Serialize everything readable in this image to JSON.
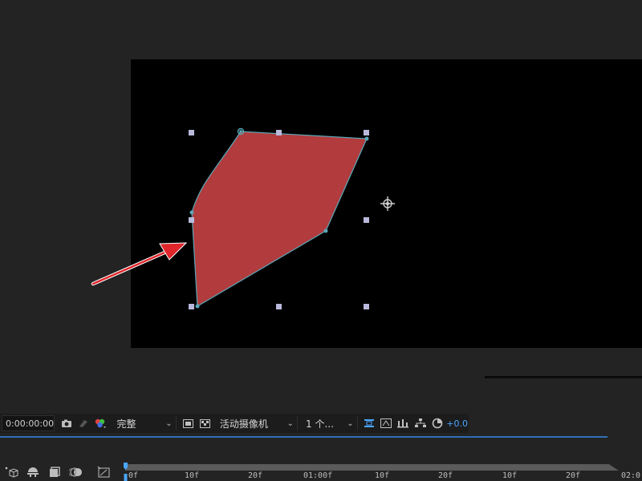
{
  "toolbar": {
    "timecode": "0:00:00:00",
    "resolution": "完整",
    "camera": "活动摄像机",
    "views": "1 个...",
    "exposure": "+0.0",
    "icons": [
      "camera-snapshot-icon",
      "show-snapshot-icon",
      "color-channel-icon",
      "toggle-mask-icon",
      "transparency-grid-icon",
      "fast-preview-icon",
      "timeline-icon",
      "flowchart-icon",
      "reset-exposure-icon"
    ]
  },
  "timeline": {
    "ticks": [
      "0f",
      "10f",
      "20f",
      "01:00f",
      "10f",
      "20f",
      "10f",
      "20f",
      "02:0"
    ],
    "controls": [
      "shy-layers-icon",
      "frame-blend-icon",
      "motion-blur-icon",
      "graph-editor-icon",
      "draft-3d-icon"
    ]
  },
  "colors": {
    "shape_fill": "#b13b3d",
    "path_stroke": "#5aa8b8",
    "arrow": "#e0252b",
    "accent": "#4aa6ff"
  }
}
